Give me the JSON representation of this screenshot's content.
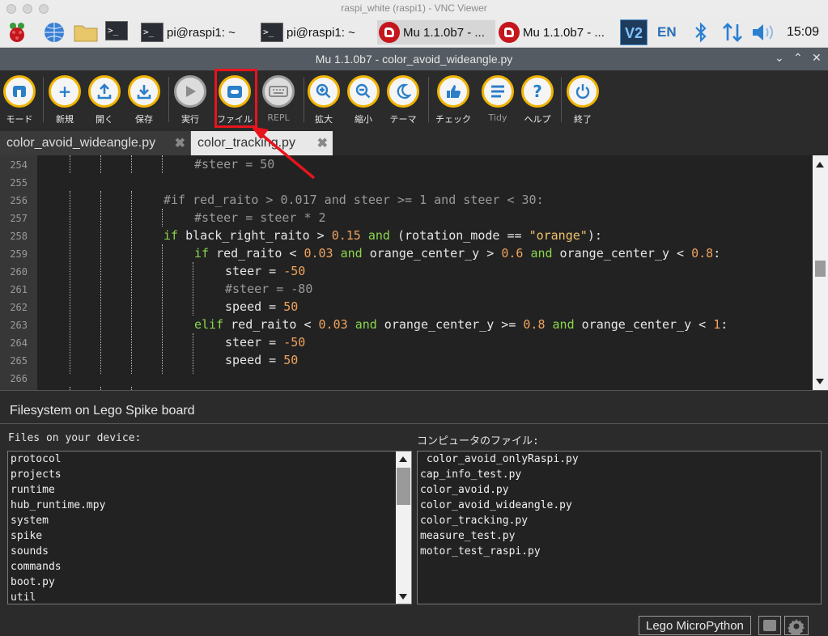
{
  "mac_window": {
    "title": "raspi_white (raspi1) - VNC Viewer"
  },
  "taskbar": {
    "tasks": [
      {
        "label": "pi@raspi1: ~"
      },
      {
        "label": "pi@raspi1: ~"
      },
      {
        "label": "Mu 1.1.0b7 - ..."
      },
      {
        "label": "Mu 1.1.0b7 - ..."
      }
    ],
    "lang": "EN",
    "clock": "15:09",
    "icons": [
      "raspberry-menu-icon",
      "web-browser-icon",
      "file-manager-icon",
      "terminal-icon",
      "vnc-icon",
      "bluetooth-icon",
      "network-icon",
      "volume-icon"
    ]
  },
  "mu_window": {
    "title": "Mu 1.1.0b7 - color_avoid_wideangle.py"
  },
  "toolbar": {
    "buttons": [
      {
        "label": "モード",
        "icon": "mode-icon"
      },
      {
        "label": "新規",
        "icon": "plus-icon"
      },
      {
        "label": "開く",
        "icon": "upload-icon"
      },
      {
        "label": "保存",
        "icon": "download-icon"
      },
      {
        "label": "実行",
        "icon": "play-icon"
      },
      {
        "label": "ファイル",
        "icon": "files-icon"
      },
      {
        "label": "REPL",
        "icon": "keyboard-icon"
      },
      {
        "label": "拡大",
        "icon": "zoom-in-icon"
      },
      {
        "label": "縮小",
        "icon": "zoom-out-icon"
      },
      {
        "label": "テーマ",
        "icon": "moon-icon"
      },
      {
        "label": "チェック",
        "icon": "thumbs-up-icon"
      },
      {
        "label": "Tidy",
        "icon": "tidy-icon"
      },
      {
        "label": "ヘルプ",
        "icon": "help-icon"
      },
      {
        "label": "終了",
        "icon": "power-icon"
      }
    ]
  },
  "tabs": [
    {
      "label": "color_avoid_wideangle.py",
      "active": false
    },
    {
      "label": "color_tracking.py",
      "active": true
    }
  ],
  "editor": {
    "lines": [
      {
        "num": "254",
        "text": "#steer = 50"
      },
      {
        "num": "255",
        "text": ""
      },
      {
        "num": "256",
        "text": "#if red_raito > 0.017 and steer >= 1 and steer < 30:"
      },
      {
        "num": "257",
        "text": "#steer = steer * 2"
      },
      {
        "num": "258",
        "text": "if black_right_raito > 0.15 and (rotation_mode == \"orange\"):"
      },
      {
        "num": "259",
        "text": "if red_raito < 0.03 and orange_center_y > 0.6 and orange_center_y < 0.8:"
      },
      {
        "num": "260",
        "text": "steer = -50"
      },
      {
        "num": "261",
        "text": "#steer = -80"
      },
      {
        "num": "262",
        "text": "speed = 50"
      },
      {
        "num": "263",
        "text": "elif red_raito < 0.03 and orange_center_y >= 0.8 and orange_center_y < 1:"
      },
      {
        "num": "264",
        "text": "steer = -50"
      },
      {
        "num": "265",
        "text": "speed = 50"
      },
      {
        "num": "266",
        "text": ""
      }
    ]
  },
  "filesystem": {
    "title": "Filesystem on Lego Spike board",
    "device_label": "Files on your device:",
    "computer_label": "コンピュータのファイル:",
    "device_files": [
      "protocol",
      "projects",
      "runtime",
      "hub_runtime.mpy",
      "system",
      "spike",
      "sounds",
      "commands",
      "boot.py",
      "util"
    ],
    "computer_files": [
      " color_avoid_onlyRaspi.py",
      "cap_info_test.py",
      "color_avoid.py",
      "color_avoid_wideangle.py",
      "color_tracking.py",
      "measure_test.py",
      "motor_test_raspi.py"
    ]
  },
  "status": {
    "mode": "Lego MicroPython"
  },
  "annotation": {
    "highlight_color": "#e8141c",
    "target": "ファイル"
  },
  "colors": {
    "accent_ring": "#f0b400",
    "icon_blue": "#2a7fc9",
    "keyword": "#8bd64b",
    "number": "#f0a35e",
    "string": "#f0c36a"
  }
}
